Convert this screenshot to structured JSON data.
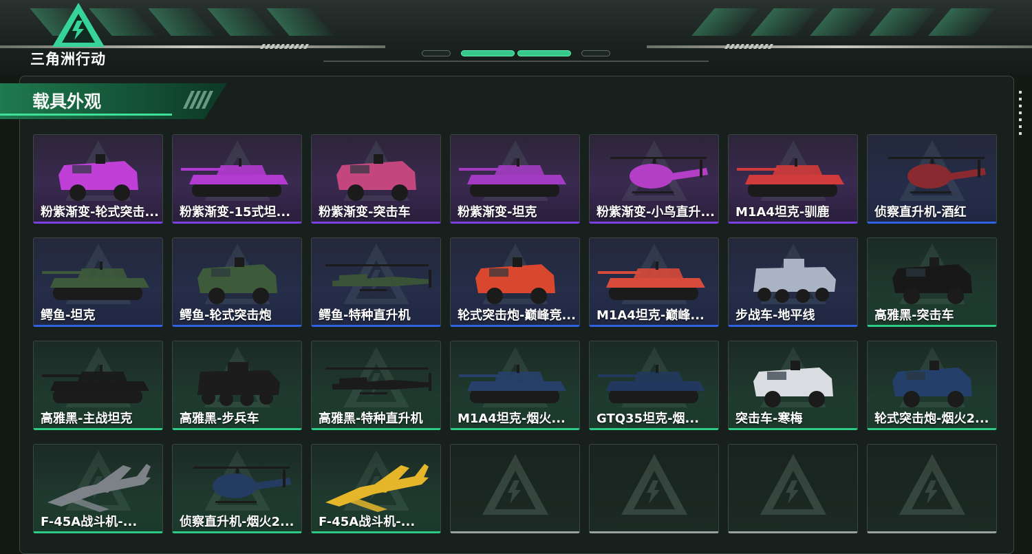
{
  "logo": {
    "text": "三角洲行动"
  },
  "section": {
    "title": "载具外观"
  },
  "colors": {
    "accent_green": "#2ecb87",
    "rarity_purple": "#7a3fe0",
    "rarity_blue": "#2e62e0",
    "rarity_green": "#2ecb87"
  },
  "items": [
    {
      "label": "粉紫渐变-轮式突击...",
      "rarity": "purple",
      "icon": "armored-car-icon",
      "tint": "#c03fd6"
    },
    {
      "label": "粉紫渐变-15式坦...",
      "rarity": "purple",
      "icon": "tank-icon",
      "tint": "#b23ad0"
    },
    {
      "label": "粉紫渐变-突击车",
      "rarity": "purple",
      "icon": "assault-vehicle-icon",
      "tint": "#c4467e"
    },
    {
      "label": "粉紫渐变-坦克",
      "rarity": "purple",
      "icon": "tank-icon",
      "tint": "#a33bc2"
    },
    {
      "label": "粉紫渐变-小鸟直升...",
      "rarity": "purple",
      "icon": "helicopter-icon",
      "tint": "#b53ec7"
    },
    {
      "label": "M1A4坦克-驯鹿",
      "rarity": "purple",
      "icon": "tank-icon",
      "tint": "#d23b3b"
    },
    {
      "label": "侦察直升机-酒红",
      "rarity": "blue",
      "icon": "helicopter-icon",
      "tint": "#8a2a30"
    },
    {
      "label": "鳄鱼-坦克",
      "rarity": "blue",
      "icon": "tank-icon",
      "tint": "#3d5a3a"
    },
    {
      "label": "鳄鱼-轮式突击炮",
      "rarity": "blue",
      "icon": "armored-car-icon",
      "tint": "#3d5a3a"
    },
    {
      "label": "鳄鱼-特种直升机",
      "rarity": "blue",
      "icon": "attack-helicopter-icon",
      "tint": "#3a5238"
    },
    {
      "label": "轮式突击炮-巅峰竞...",
      "rarity": "blue",
      "icon": "armored-car-icon",
      "tint": "#d9482e"
    },
    {
      "label": "M1A4坦克-巅峰...",
      "rarity": "blue",
      "icon": "tank-icon",
      "tint": "#d84a3a"
    },
    {
      "label": "步战车-地平线",
      "rarity": "blue",
      "icon": "ifv-icon",
      "tint": "#aab4c4"
    },
    {
      "label": "高雅黑-突击车",
      "rarity": "green",
      "icon": "assault-vehicle-icon",
      "tint": "#181818"
    },
    {
      "label": "高雅黑-主战坦克",
      "rarity": "green",
      "icon": "tank-icon",
      "tint": "#1a1a1a"
    },
    {
      "label": "高雅黑-步兵车",
      "rarity": "green",
      "icon": "ifv-icon",
      "tint": "#1c1c1c"
    },
    {
      "label": "高雅黑-特种直升机",
      "rarity": "green",
      "icon": "attack-helicopter-icon",
      "tint": "#1b1b1b"
    },
    {
      "label": "M1A4坦克-烟火...",
      "rarity": "green",
      "icon": "tank-icon",
      "tint": "#27406a"
    },
    {
      "label": "GTQ35坦克-烟...",
      "rarity": "green",
      "icon": "tank-icon",
      "tint": "#22385e"
    },
    {
      "label": "突击车-寒梅",
      "rarity": "green",
      "icon": "assault-vehicle-icon",
      "tint": "#d9dde2"
    },
    {
      "label": "轮式突击炮-烟火2...",
      "rarity": "green",
      "icon": "armored-car-icon",
      "tint": "#24406a"
    },
    {
      "label": "F-45A战斗机-...",
      "rarity": "green",
      "icon": "fighter-jet-icon",
      "tint": "#7c8288"
    },
    {
      "label": "侦察直升机-烟火2...",
      "rarity": "green",
      "icon": "helicopter-icon",
      "tint": "#253c62"
    },
    {
      "label": "F-45A战斗机-...",
      "rarity": "green",
      "icon": "fighter-jet-icon",
      "tint": "#e5b52a"
    },
    {
      "label": "",
      "rarity": "empty",
      "icon": "",
      "tint": ""
    },
    {
      "label": "",
      "rarity": "empty",
      "icon": "",
      "tint": ""
    },
    {
      "label": "",
      "rarity": "empty",
      "icon": "",
      "tint": ""
    },
    {
      "label": "",
      "rarity": "empty",
      "icon": "",
      "tint": ""
    }
  ]
}
